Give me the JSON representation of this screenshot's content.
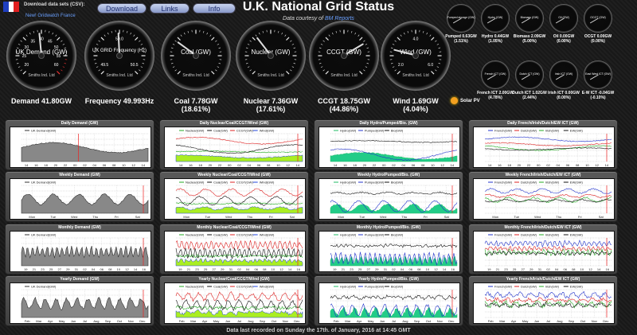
{
  "header": {
    "download_label": "Download data sets (CSV):",
    "buttons": [
      "Download",
      "Links",
      "Info"
    ],
    "new_link": "New! Gridwatch France",
    "title": "U.K. National Grid Status",
    "subtitle_prefix": "Data courtesy of",
    "subtitle_link": "BM Reports"
  },
  "flag_colors": [
    "#1f3fbf",
    "#ffffff",
    "#e02020"
  ],
  "main_gauges": [
    {
      "label": "UK Demand (GW)",
      "maker": "Smiths Ind. Ltd",
      "ticks": [
        "20",
        "25",
        "30",
        "35",
        "40",
        "45",
        "50",
        "55",
        "60"
      ],
      "value_frac": 0.48,
      "readout": [
        "Demand 41.80GW"
      ]
    },
    {
      "label": "UK GRID Frequency (Hz)",
      "maker": "Smiths Ind. Ltd",
      "ticks": [
        "49.5",
        "50.0",
        "50.5"
      ],
      "value_frac": 0.49,
      "readout": [
        "Frequency 49.993Hz"
      ]
    },
    {
      "label": "Coal (GW)",
      "maker": "Smiths Ind. Ltd",
      "ticks": [],
      "value_frac": 0.3,
      "readout": [
        "Coal 7.78GW",
        "(18.61%)"
      ]
    },
    {
      "label": "Nuclear (GW)",
      "maker": "Smiths Ind. Ltd",
      "ticks": [],
      "value_frac": 0.36,
      "readout": [
        "Nuclear 7.36GW",
        "(17.61%)"
      ]
    },
    {
      "label": "CCGT (GW)",
      "maker": "Smiths Ind. Ltd",
      "ticks": [],
      "value_frac": 0.72,
      "readout": [
        "CCGT 18.75GW",
        "(44.86%)"
      ]
    },
    {
      "label": "Wind (GW)",
      "maker": "Smiths Ind. Ltd",
      "ticks": [
        "2.0",
        "4.0",
        "6.0"
      ],
      "value_frac": 0.22,
      "readout": [
        "Wind 1.69GW",
        "(4.04%)"
      ]
    }
  ],
  "mini_gauges": [
    {
      "label": "Pumped storage (GW)",
      "readout": [
        "Pumped 0.63GW",
        "(1.51%)"
      ]
    },
    {
      "label": "Hydro (GW)",
      "readout": [
        "Hydro 0.44GW",
        "(1.05%)"
      ]
    },
    {
      "label": "Biomass (GW)",
      "readout": [
        "Biomass 2.09GW",
        "(5.00%)"
      ]
    },
    {
      "label": "Oil (GW)",
      "readout": [
        "Oil 0.00GW",
        "(0.00%)"
      ]
    },
    {
      "label": "OCGT (GW)",
      "readout": [
        "OCGT 0.00GW",
        "(0.00%)"
      ]
    },
    {
      "label": "French ICT (GW)",
      "readout": [
        "French ICT 2.00GW",
        "(4.78%)"
      ]
    },
    {
      "label": "Dutch ICT (GW)",
      "readout": [
        "Dutch ICT 1.02GW",
        "(2.44%)"
      ]
    },
    {
      "label": "Irish ICT (GW)",
      "readout": [
        "Irish ICT 0.00GW",
        "(0.00%)"
      ]
    },
    {
      "label": "East West ICT (GW)",
      "readout": [
        "E-W ICT -0.04GW",
        "(-0.10%)"
      ]
    }
  ],
  "solar_label": "Solar PV",
  "panels": [
    {
      "title": "Daily Demand (GW)",
      "legend": [
        "UK Demand(GW)"
      ],
      "xlabels": [
        "14",
        "16",
        "18",
        "20",
        "22",
        "00",
        "02",
        "04",
        "06",
        "08",
        "10",
        "12",
        "14"
      ]
    },
    {
      "title": "Daily Nuclear/Coal/CCGT/Wind (GW)",
      "legend": [
        "Nuclear(GW)",
        "Coal(GW)",
        "CCGT(GW)",
        "Wind(GW)"
      ],
      "xlabels": [
        "14",
        "16",
        "18",
        "20",
        "22",
        "00",
        "02",
        "04",
        "06",
        "08",
        "10",
        "12",
        "14"
      ]
    },
    {
      "title": "Daily Hydro/Pumped/Bio. (GW)",
      "legend": [
        "Hydro(GW)",
        "Pumped(GW)",
        "Bio(GW)"
      ],
      "xlabels": [
        "14",
        "16",
        "18",
        "20",
        "22",
        "00",
        "02",
        "04",
        "06",
        "08",
        "10",
        "12",
        "14"
      ]
    },
    {
      "title": "Daily French/Irish/Dutch/EW ICT (GW)",
      "legend": [
        "French(GW)",
        "Dutch(GW)",
        "Irish(GW)",
        "EW(GW)"
      ],
      "xlabels": [
        "14",
        "16",
        "18",
        "20",
        "22",
        "00",
        "02",
        "04",
        "06",
        "08",
        "10",
        "12",
        "14"
      ]
    },
    {
      "title": "Weekly Demand (GW)",
      "legend": [
        "UK Demand(GW)"
      ],
      "xlabels": [
        "Mon",
        "Tue",
        "Wed",
        "Thu",
        "Fri",
        "Sat"
      ]
    },
    {
      "title": "Weekly Nuclear/Coal/CCGT/Wind (GW)",
      "legend": [
        "Nuclear(GW)",
        "Coal(GW)",
        "CCGT(GW)",
        "Wind(GW)"
      ],
      "xlabels": [
        "Mon",
        "Tue",
        "Wed",
        "Thu",
        "Fri",
        "Sat"
      ]
    },
    {
      "title": "Weekly Hydro/Pumped/Bio. (GW)",
      "legend": [
        "Hydro(GW)",
        "Pumped(GW)",
        "Bio(GW)"
      ],
      "xlabels": [
        "Mon",
        "Tue",
        "Wed",
        "Thu",
        "Fri",
        "Sat"
      ]
    },
    {
      "title": "Weekly French/Irish/Dutch/EW ICT (GW)",
      "legend": [
        "French(GW)",
        "Dutch(GW)",
        "Irish(GW)",
        "EW(GW)"
      ],
      "xlabels": [
        "Mon",
        "Tue",
        "Wed",
        "Thu",
        "Fri",
        "Sat"
      ]
    },
    {
      "title": "Monthly Demand (GW)",
      "legend": [
        "UK Demand(GW)"
      ],
      "xlabels": [
        "19",
        "21",
        "23",
        "25",
        "27",
        "29",
        "31",
        "02",
        "04",
        "06",
        "08",
        "10",
        "12",
        "14",
        "16"
      ]
    },
    {
      "title": "Monthly Nuclear/Coal/CCGT/Wind (GW)",
      "legend": [
        "Nuclear(GW)",
        "Coal(GW)",
        "CCGT(GW)",
        "Wind(GW)"
      ],
      "xlabels": [
        "19",
        "21",
        "23",
        "25",
        "27",
        "29",
        "31",
        "02",
        "04",
        "06",
        "08",
        "10",
        "12",
        "14",
        "16"
      ]
    },
    {
      "title": "Monthly Hydro/Pumped/Bio. (GW)",
      "legend": [
        "Hydro(GW)",
        "Pumped(GW)",
        "Bio(GW)"
      ],
      "xlabels": [
        "19",
        "21",
        "23",
        "25",
        "27",
        "29",
        "31",
        "02",
        "04",
        "06",
        "08",
        "10",
        "12",
        "14",
        "16"
      ]
    },
    {
      "title": "Monthly French/Irish/Dutch/EW ICT (GW)",
      "legend": [
        "French(GW)",
        "Dutch(GW)",
        "Irish(GW)",
        "EW(GW)"
      ],
      "xlabels": [
        "19",
        "21",
        "23",
        "25",
        "27",
        "29",
        "31",
        "02",
        "04",
        "06",
        "08",
        "10",
        "12",
        "14",
        "16"
      ]
    },
    {
      "title": "Yearly Demand (GW)",
      "legend": [
        "UK Demand(GW)"
      ],
      "xlabels": [
        "Feb",
        "Mar",
        "Apr",
        "May",
        "Jun",
        "Jul",
        "Aug",
        "Sep",
        "Oct",
        "Nov",
        "Dec"
      ]
    },
    {
      "title": "Yearly Nuclear/Coal/CCGT/Wind (GW)",
      "legend": [
        "Nuclear(GW)",
        "Coal(GW)",
        "CCGT(GW)",
        "Wind(GW)"
      ],
      "xlabels": [
        "Feb",
        "Mar",
        "Apr",
        "May",
        "Jun",
        "Jul",
        "Aug",
        "Sep",
        "Oct",
        "Nov",
        "Dec"
      ]
    },
    {
      "title": "Yearly Hydro/Pumped/Bio. (GW)",
      "legend": [
        "Hydro(GW)",
        "Pumped(GW)",
        "Bio(GW)"
      ],
      "xlabels": [
        "Feb",
        "Mar",
        "Apr",
        "May",
        "Jun",
        "Jul",
        "Aug",
        "Sep",
        "Oct",
        "Nov",
        "Dec"
      ]
    },
    {
      "title": "Yearly French/Irish/Dutch/EW ICT (GW)",
      "legend": [
        "French(GW)",
        "Dutch(GW)",
        "Irish(GW)",
        "EW(GW)"
      ],
      "xlabels": [
        "Feb",
        "Mar",
        "Apr",
        "May",
        "Jun",
        "Jul",
        "Aug",
        "Sep",
        "Oct",
        "Nov",
        "Dec"
      ]
    }
  ],
  "series_colors": {
    "demand": "#333333",
    "nuclear": "#22aa22",
    "coal": "#111111",
    "ccgt": "#dd2222",
    "wind": "#2244dd",
    "hydro": "#22bb66",
    "pumped": "#2233cc",
    "bio": "#111111",
    "french": "#2233cc",
    "dutch": "#dd2222",
    "irish": "#22aa22",
    "ew": "#111111",
    "wind_fill": "#aaee22",
    "hydro_fill": "#22cc88"
  },
  "footer": "Data last recorded on Sunday the 17th. of January, 2016 at 14:45 GMT"
}
